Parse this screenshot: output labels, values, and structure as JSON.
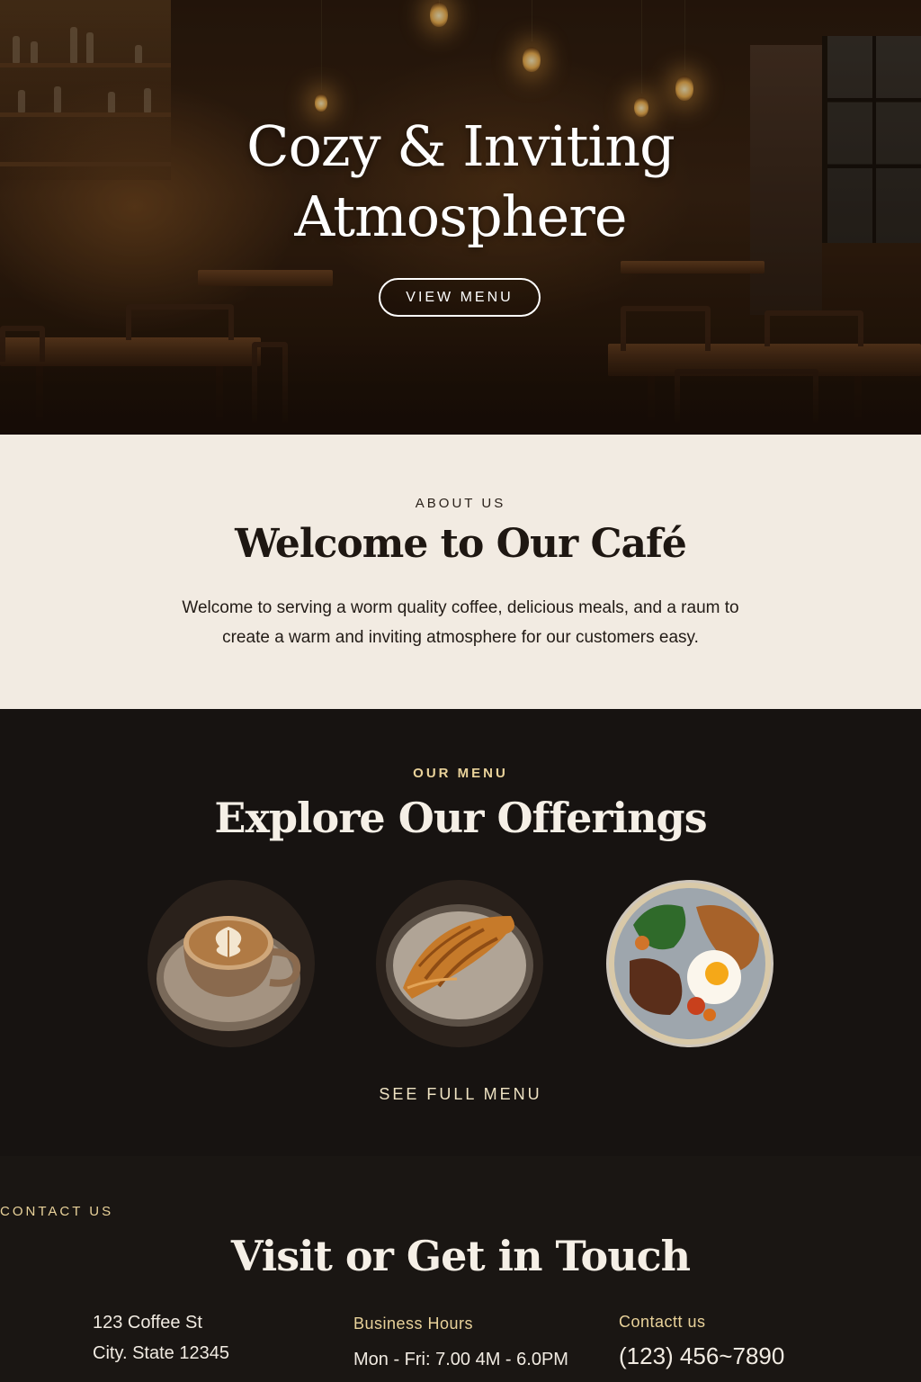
{
  "hero": {
    "title_line1": "Cozy & Inviting",
    "title_line2": "Atmosphere",
    "button_label": "VIEW MENU"
  },
  "about": {
    "eyebrow": "ABOUT US",
    "title": "Welcome to Our Café",
    "text_line1": "Welcome to serving a worm quality coffee, delicious meals, and a raum to",
    "text_line2": "create a warm and inviting atmosphere for our customers easy."
  },
  "menu": {
    "eyebrow": "OUR MENU",
    "title": "Explore Our Offerings",
    "dishes": [
      "latte-art-coffee",
      "croissant",
      "breakfast-plate"
    ],
    "see_full_label": "SEE FULL MENU"
  },
  "contact": {
    "eyebrow": "CONTACT US",
    "title": "Visit or Get in Touch",
    "address_line1": "123 Coffee St",
    "address_line2": "City. State 12345",
    "hours_heading": "Business Hours",
    "hours_value": "Mon - Fri: 7.00 4M - 6.0PM",
    "contact_heading": "Contactt us",
    "phone": "(123) 456~7890"
  },
  "colors": {
    "cream": "#f2ebe2",
    "dark": "#171311",
    "gold": "#e9d29a"
  }
}
